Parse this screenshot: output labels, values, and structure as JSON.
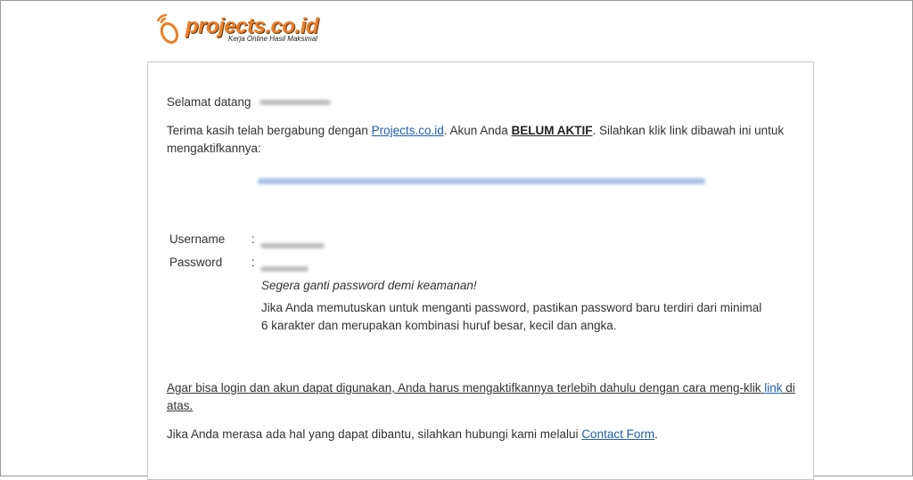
{
  "logo": {
    "text": "projects.co.id",
    "tagline": "Kerja Online Hasil Maksimal",
    "colors": {
      "brand_orange": "#f07d22",
      "shadow": "#5a3a1a"
    }
  },
  "email": {
    "greeting_prefix": "Selamat datang",
    "intro_before_link": "Terima kasih telah bergabung dengan ",
    "intro_link": "Projects.co.id",
    "intro_after_link": ". Akun Anda ",
    "status_text": "BELUM AKTIF",
    "intro_after_status": ". Silahkan klik link dibawah ini untuk",
    "intro_line2": "mengaktifkannya:",
    "username_label": "Username",
    "password_label": "Password",
    "colon": ":",
    "password_advice": "Segera ganti password demi keamanan!",
    "password_rule_line1": "Jika Anda memutuskan untuk menganti password, pastikan password baru terdiri dari minimal",
    "password_rule_line2": "6 karakter dan merupakan kombinasi huruf besar, kecil dan angka.",
    "note_line1": "Agar bisa login dan akun dapat digunakan, Anda harus mengaktifkannya terlebih dahulu dengan cara meng-klik ",
    "note_link": "link",
    "note_after_link": " di",
    "note_line2": "atas.",
    "contact_before_link": "Jika Anda merasa ada hal yang dapat dibantu, silahkan hubungi kami melalui ",
    "contact_link": "Contact Form",
    "contact_after_link": "."
  },
  "colors": {
    "link": "#1f5fb0",
    "text": "#333333",
    "card_border": "#c9c9c9",
    "frame_border": "#9a9a9a"
  }
}
